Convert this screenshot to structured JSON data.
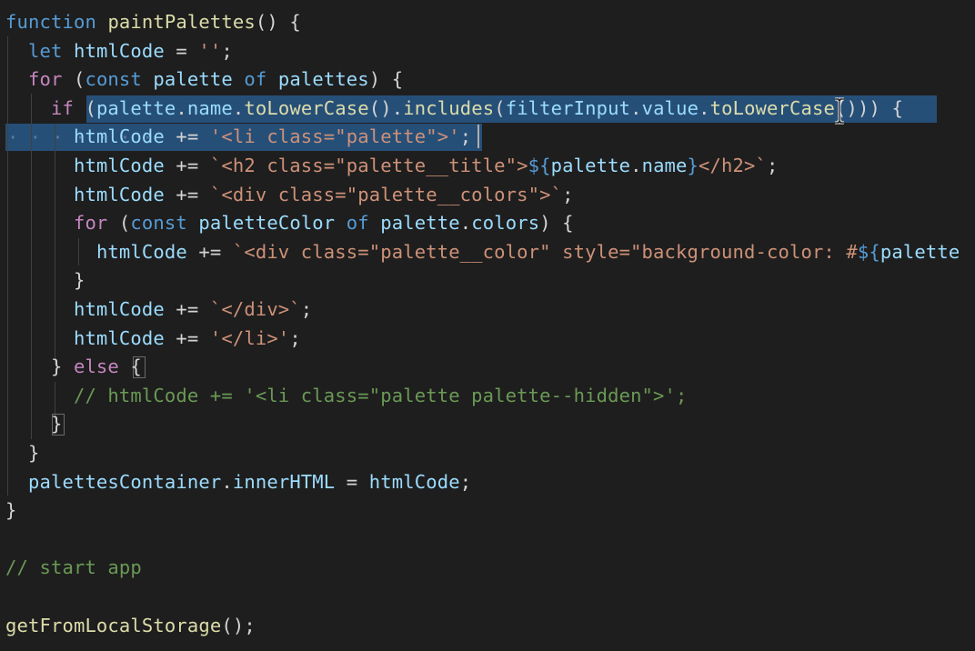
{
  "editor": {
    "lines": [
      [
        [
          "kw",
          "function"
        ],
        [
          "pun",
          " "
        ],
        [
          "fn",
          "paintPalettes"
        ],
        [
          "pun",
          "() {"
        ]
      ],
      [
        [
          "pun",
          "  "
        ],
        [
          "kw",
          "let"
        ],
        [
          "pun",
          " "
        ],
        [
          "var",
          "htmlCode"
        ],
        [
          "pun",
          " = "
        ],
        [
          "str",
          "''"
        ],
        [
          "pun",
          ";"
        ]
      ],
      [
        [
          "pun",
          "  "
        ],
        [
          "ctl",
          "for"
        ],
        [
          "pun",
          " ("
        ],
        [
          "kw",
          "const"
        ],
        [
          "pun",
          " "
        ],
        [
          "var",
          "palette"
        ],
        [
          "pun",
          " "
        ],
        [
          "kw",
          "of"
        ],
        [
          "pun",
          " "
        ],
        [
          "var",
          "palettes"
        ],
        [
          "pun",
          ") {"
        ]
      ],
      [
        [
          "pun",
          "    "
        ],
        [
          "ctl",
          "if"
        ],
        [
          "pun",
          " ("
        ],
        [
          "var",
          "palette"
        ],
        [
          "pun",
          "."
        ],
        [
          "var",
          "name"
        ],
        [
          "pun",
          "."
        ],
        [
          "fn",
          "toLowerCase"
        ],
        [
          "pun",
          "()."
        ],
        [
          "fn",
          "includes"
        ],
        [
          "pun",
          "("
        ],
        [
          "var",
          "filterInput"
        ],
        [
          "pun",
          "."
        ],
        [
          "var",
          "value"
        ],
        [
          "pun",
          "."
        ],
        [
          "fn",
          "toLowerCase"
        ],
        [
          "pun",
          "())) {"
        ]
      ],
      [
        [
          "pun",
          "      "
        ],
        [
          "var",
          "htmlCode"
        ],
        [
          "pun",
          " += "
        ],
        [
          "str",
          "'<li class=\"palette\">'"
        ],
        [
          "pun",
          ";"
        ]
      ],
      [
        [
          "pun",
          "      "
        ],
        [
          "var",
          "htmlCode"
        ],
        [
          "pun",
          " += "
        ],
        [
          "str",
          "`<h2 class=\"palette__title\">"
        ],
        [
          "kw",
          "${"
        ],
        [
          "var",
          "palette"
        ],
        [
          "pun",
          "."
        ],
        [
          "var",
          "name"
        ],
        [
          "kw",
          "}"
        ],
        [
          "str",
          "</h2>`"
        ],
        [
          "pun",
          ";"
        ]
      ],
      [
        [
          "pun",
          "      "
        ],
        [
          "var",
          "htmlCode"
        ],
        [
          "pun",
          " += "
        ],
        [
          "str",
          "`<div class=\"palette__colors\">`"
        ],
        [
          "pun",
          ";"
        ]
      ],
      [
        [
          "pun",
          "      "
        ],
        [
          "ctl",
          "for"
        ],
        [
          "pun",
          " ("
        ],
        [
          "kw",
          "const"
        ],
        [
          "pun",
          " "
        ],
        [
          "var",
          "paletteColor"
        ],
        [
          "pun",
          " "
        ],
        [
          "kw",
          "of"
        ],
        [
          "pun",
          " "
        ],
        [
          "var",
          "palette"
        ],
        [
          "pun",
          "."
        ],
        [
          "var",
          "colors"
        ],
        [
          "pun",
          ") {"
        ]
      ],
      [
        [
          "pun",
          "        "
        ],
        [
          "var",
          "htmlCode"
        ],
        [
          "pun",
          " += "
        ],
        [
          "str",
          "`<div class=\"palette__color\" style=\"background-color: #"
        ],
        [
          "kw",
          "${"
        ],
        [
          "var",
          "palette"
        ]
      ],
      [
        [
          "pun",
          "      }"
        ]
      ],
      [
        [
          "pun",
          "      "
        ],
        [
          "var",
          "htmlCode"
        ],
        [
          "pun",
          " += "
        ],
        [
          "str",
          "`</div>`"
        ],
        [
          "pun",
          ";"
        ]
      ],
      [
        [
          "pun",
          "      "
        ],
        [
          "var",
          "htmlCode"
        ],
        [
          "pun",
          " += "
        ],
        [
          "str",
          "'</li>'"
        ],
        [
          "pun",
          ";"
        ]
      ],
      [
        [
          "pun",
          "    } "
        ],
        [
          "ctl",
          "else"
        ],
        [
          "pun",
          " {"
        ]
      ],
      [
        [
          "pun",
          "      "
        ],
        [
          "cmt",
          "// htmlCode += '<li class=\"palette palette--hidden\">';"
        ]
      ],
      [
        [
          "pun",
          "    }"
        ]
      ],
      [
        [
          "pun",
          "  }"
        ]
      ],
      [
        [
          "pun",
          "  "
        ],
        [
          "var",
          "palettesContainer"
        ],
        [
          "pun",
          "."
        ],
        [
          "var",
          "innerHTML"
        ],
        [
          "pun",
          " = "
        ],
        [
          "var",
          "htmlCode"
        ],
        [
          "pun",
          ";"
        ]
      ],
      [
        [
          "pun",
          "}"
        ]
      ],
      [
        [
          "pun",
          ""
        ]
      ],
      [
        [
          "cmt",
          "// start app"
        ]
      ],
      [
        [
          "pun",
          ""
        ]
      ],
      [
        [
          "fn",
          "getFromLocalStorage"
        ],
        [
          "pun",
          "();"
        ]
      ]
    ],
    "whitespace_markers": "· · · · · · ·",
    "colors": {
      "background": "#1e1e1e",
      "selection": "#264f78",
      "keyword": "#569cd6",
      "control": "#c586c0",
      "function": "#dcdcaa",
      "variable": "#9cdcfe",
      "string": "#ce9178",
      "comment": "#6a9955"
    }
  }
}
